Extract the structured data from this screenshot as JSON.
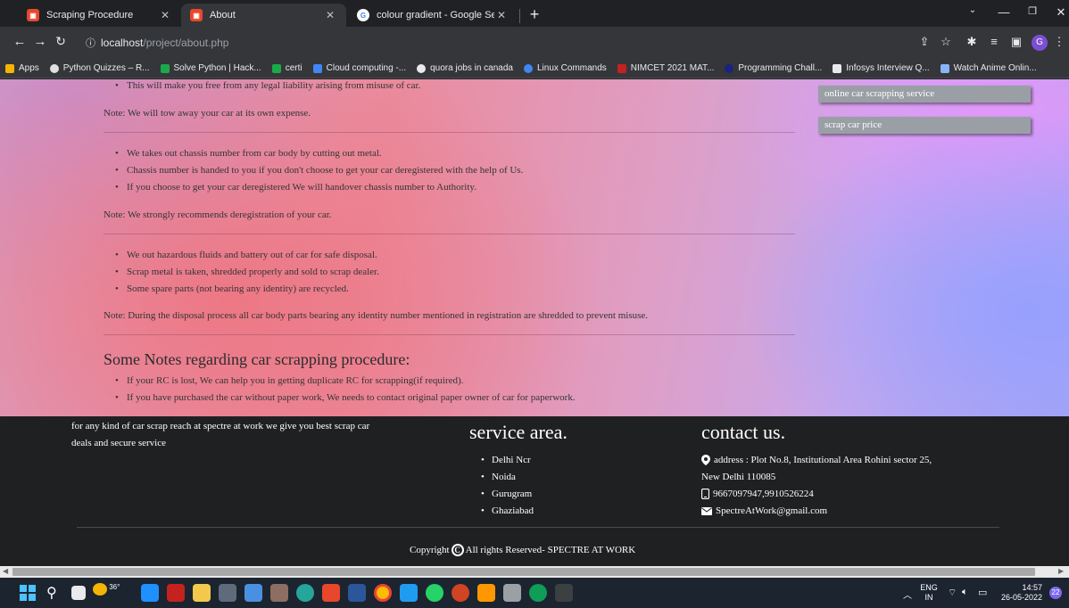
{
  "browser": {
    "tabs": [
      {
        "title": "Scraping Procedure",
        "favicon_color": "#e8472b",
        "active": false
      },
      {
        "title": "About",
        "favicon_color": "#e8472b",
        "active": true
      },
      {
        "title": "colour gradient - Google Search",
        "favicon_color": "#ffffff",
        "active": false
      }
    ],
    "address": {
      "host": "localhost",
      "path": "/project/about.php"
    },
    "profile_letter": "G",
    "bookmarks": [
      {
        "label": "Apps",
        "color": "#f4b400"
      },
      {
        "label": "Python Quizzes – R...",
        "color": "#e0e0e0"
      },
      {
        "label": "Solve Python | Hack...",
        "color": "#1ba94c"
      },
      {
        "label": "certi",
        "color": "#1ba94c"
      },
      {
        "label": "Cloud computing -...",
        "color": "#4285f4"
      },
      {
        "label": "quora jobs in canada",
        "color": "#e8eaed"
      },
      {
        "label": "Linux Commands",
        "color": "#4285f4"
      },
      {
        "label": "NIMCET 2021 MAT...",
        "color": "#c5221f"
      },
      {
        "label": "Programming Chall...",
        "color": "#1a237e"
      },
      {
        "label": "Infosys Interview Q...",
        "color": "#e8eaed"
      },
      {
        "label": "Watch Anime Onlin...",
        "color": "#8ab4f8"
      }
    ]
  },
  "page": {
    "section1": {
      "bullets": [
        "This will make you free from any legal liability arising from misuse of car."
      ],
      "note": "Note: We will tow away your car at its own expense."
    },
    "section2": {
      "bullets": [
        "We takes out chassis number from car body by cutting out metal.",
        "Chassis number is handed to you if you don't choose to get your car deregistered with the help of Us.",
        "If you choose to get your car deregistered We will handover chassis number to Authority."
      ],
      "note": "Note: We strongly recommends deregistration of your car."
    },
    "section3": {
      "bullets": [
        "We out hazardous fluids and battery out of car for safe disposal.",
        "Scrap metal is taken, shredded properly and sold to scrap dealer.",
        "Some spare parts (not bearing any identity) are recycled."
      ],
      "note": "Note: During the disposal process all car body parts bearing any identity number mentioned in registration are shredded to prevent misuse."
    },
    "notes_heading": "Some Notes regarding car scrapping procedure:",
    "notes": [
      "If your RC is lost, We can help you in getting duplicate RC for scrapping(if required).",
      "If you have purchased the car without paper work, We needs to contact original paper owner of car for paperwork."
    ],
    "sidebar_buttons": [
      "online car scrapping service",
      "scrap car price"
    ]
  },
  "footer": {
    "about": "for any kind of car scrap reach at spectre at work we give you best scrap car deals and secure service",
    "service_heading": "service area.",
    "service_areas": [
      "Delhi Ncr",
      "Noida",
      "Gurugram",
      "Ghaziabad"
    ],
    "contact_heading": "contact us.",
    "address_line1": "address : Plot No.8, Institutional Area Rohini sector 25,",
    "address_line2": "New Delhi 110085",
    "phone": "9667097947,9910526224",
    "email": "SpectreAtWork@gmail.com",
    "copyright_prefix": "Copyright",
    "copyright_text": "All rights Reserved- SPECTRE AT WORK"
  },
  "taskbar": {
    "weather": "36°",
    "lang_top": "ENG",
    "lang_bottom": "IN",
    "time": "14:57",
    "date": "26-05-2022",
    "notifications": "22"
  }
}
